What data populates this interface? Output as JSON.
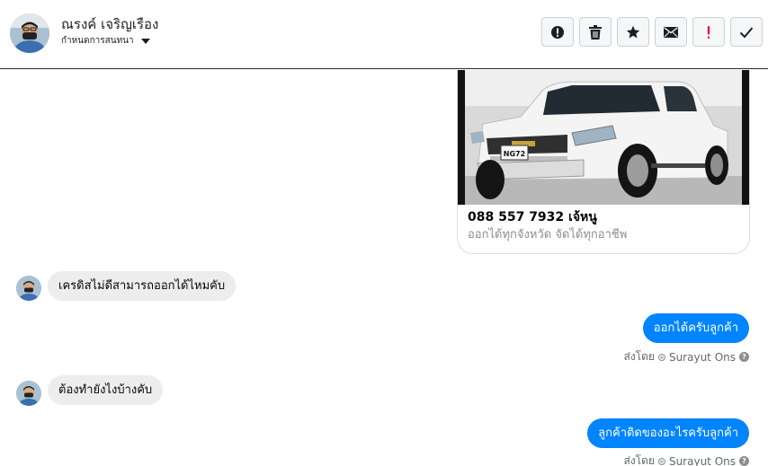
{
  "header": {
    "contact_name": "ณรงค์ เจริญเรือง",
    "convo_actions_label": "กำหนดการสนทนา",
    "toolbar": [
      {
        "name": "report-spam-button",
        "icon": "alert-circle-icon"
      },
      {
        "name": "delete-button",
        "icon": "trash-icon"
      },
      {
        "name": "star-button",
        "icon": "star-icon"
      },
      {
        "name": "mark-unread-button",
        "icon": "envelope-icon"
      },
      {
        "name": "mark-important-button",
        "icon": "exclamation-icon",
        "color": "#e41e3f"
      },
      {
        "name": "mark-done-button",
        "icon": "check-icon"
      }
    ]
  },
  "media_card": {
    "title": "088 557 7932 เจ้หนู",
    "subtitle": "ออกได้ทุกจังหวัด จัดได้ทุกอาชีพ",
    "plate_text": "NG72"
  },
  "messages": [
    {
      "direction": "incoming",
      "text": "เครดิสไม่ดีสามารถออกได้ไหมคับ"
    },
    {
      "direction": "outgoing",
      "text": "ออกได้ครับลูกค้า",
      "sent_by_prefix": "ส่งโดย",
      "sent_by_name": "Surayut Ons"
    },
    {
      "direction": "incoming",
      "text": "ต้องทำยังไงบ้างคับ"
    },
    {
      "direction": "outgoing",
      "text": "ลูกค้าติดของอะไรครับลูกค้า",
      "sent_by_prefix": "ส่งโดย",
      "sent_by_name": "Surayut Ons"
    }
  ],
  "colors": {
    "outgoing_bubble": "#0084ff",
    "incoming_bubble": "#ededed",
    "important_icon": "#e41e3f"
  }
}
